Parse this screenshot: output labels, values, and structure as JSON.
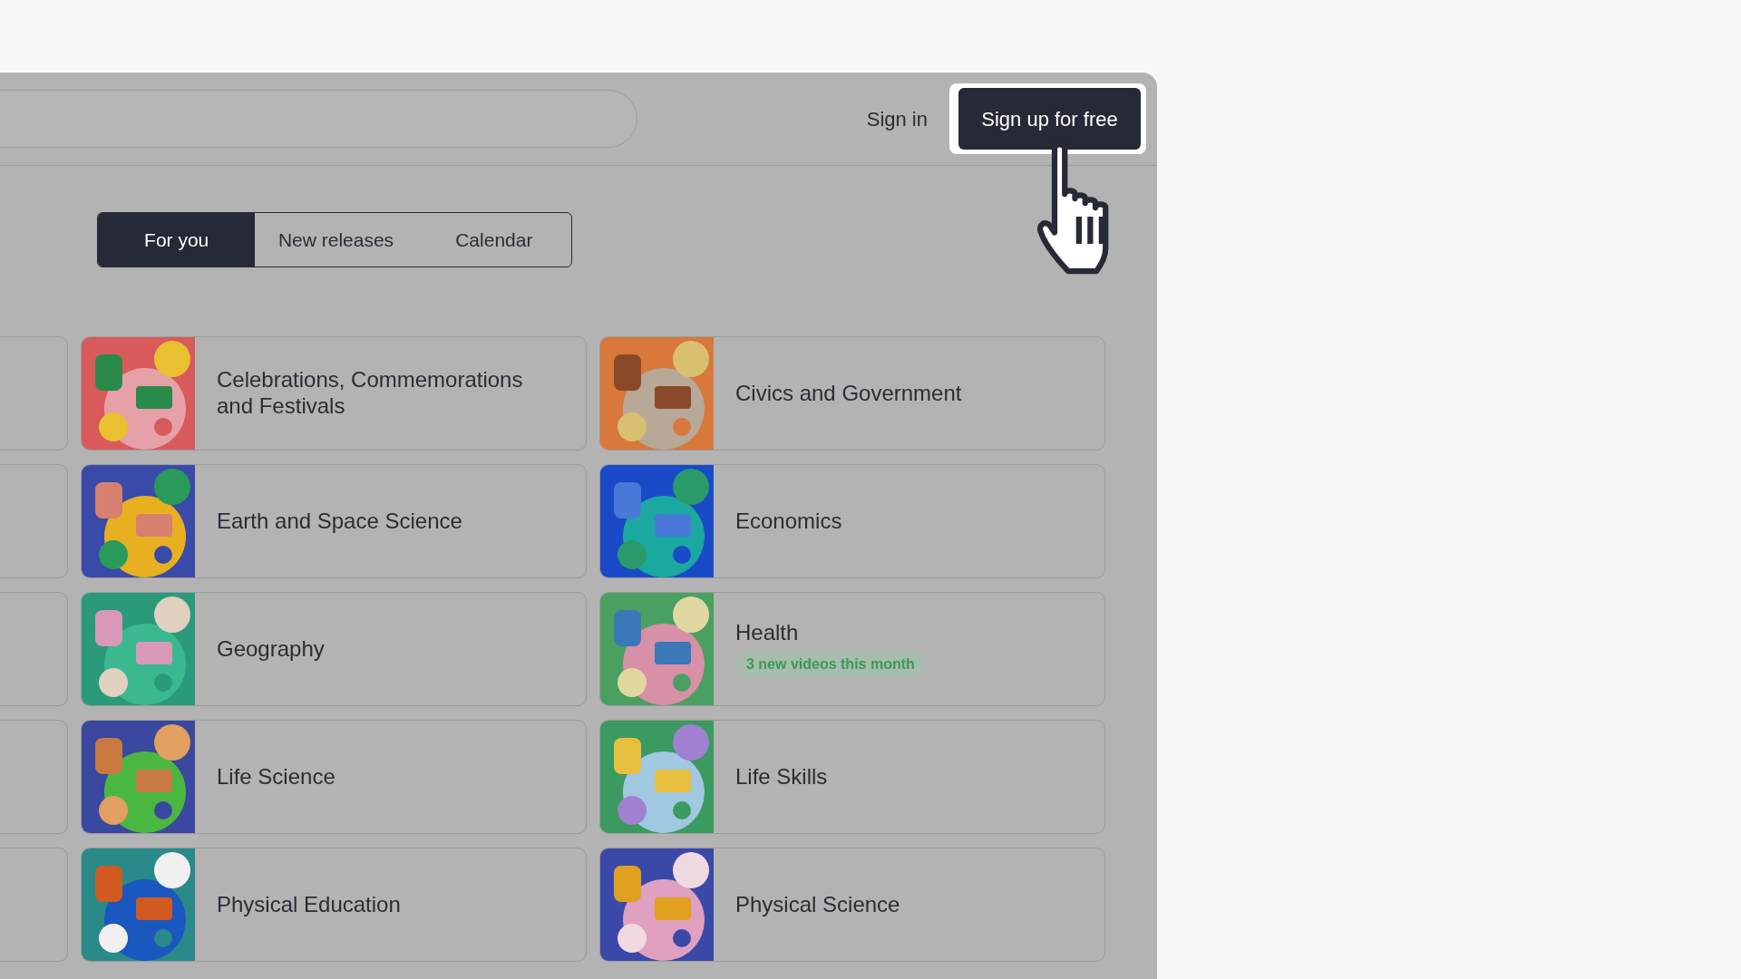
{
  "header": {
    "sign_in": "Sign in",
    "sign_up": "Sign up for free"
  },
  "tabs": [
    {
      "label": "For you",
      "selected": true
    },
    {
      "label": "New releases",
      "selected": false
    },
    {
      "label": "Calendar",
      "selected": false
    }
  ],
  "topic_rows": [
    {
      "topics": [
        {
          "title": "Celebrations, Commemorations and Festivals"
        },
        {
          "title": "Civics and Government"
        }
      ]
    },
    {
      "topics": [
        {
          "title": "Earth and Space Science"
        },
        {
          "title": "Economics"
        }
      ]
    },
    {
      "topics": [
        {
          "title": "Geography"
        },
        {
          "title": "Health",
          "badge": "3 new videos this month"
        }
      ]
    },
    {
      "topics": [
        {
          "title": "Life Science"
        },
        {
          "title": "Life Skills"
        }
      ]
    },
    {
      "topics": [
        {
          "title": "Physical Education"
        },
        {
          "title": "Physical Science"
        }
      ]
    }
  ]
}
